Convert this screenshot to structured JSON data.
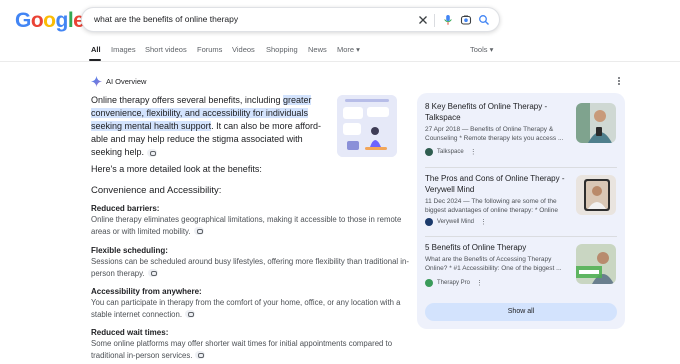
{
  "header": {
    "logo_letters": [
      "G",
      "o",
      "o",
      "g",
      "l",
      "e"
    ],
    "logo_colors": [
      "#4285f4",
      "#ea4335",
      "#fbbc05",
      "#4285f4",
      "#34a853",
      "#ea4335"
    ],
    "search_query": "what are the benefits of online therapy",
    "icons": [
      "close-icon",
      "microphone-icon",
      "lens-icon",
      "search-icon"
    ]
  },
  "tabs": {
    "items": [
      "All",
      "Images",
      "Short videos",
      "Forums",
      "Videos",
      "Shopping",
      "News",
      "More ▾"
    ],
    "active": "All",
    "tools": "Tools ▾"
  },
  "ai_overview": {
    "title": "AI Overview",
    "intro_plain_1": "Online therapy offers several benefits, including ",
    "intro_highlight": "greater convenience, flexibility, and accessibility for individuals seeking mental health support",
    "intro_plain_2": ". It can also be more afford-able and may help reduce the stigma associated with seeking help.",
    "lead": "Here's a more detailed look at the benefits:",
    "section_heading": "Convenience and Accessibility:",
    "items": [
      {
        "title": "Reduced barriers:",
        "body": "Online therapy eliminates geographical limitations, making it accessible to those in remote areas or with limited mobility."
      },
      {
        "title": "Flexible scheduling:",
        "body": "Sessions can be scheduled around busy lifestyles, offering more flexibility than traditional in-person therapy."
      },
      {
        "title": "Accessibility from anywhere:",
        "body": "You can participate in therapy from the comfort of your home, office, or any location with a stable internet connection."
      },
      {
        "title": "Reduced wait times:",
        "body": "Some online platforms may offer shorter wait times for initial appointments compared to traditional in-person services."
      }
    ]
  },
  "sources": {
    "cards": [
      {
        "title": "8 Key Benefits of Online Therapy - Talkspace",
        "meta": "27 Apr 2018 — Benefits of Online Therapy & Counseling * Remote therapy lets you access ...",
        "source": "Talkspace",
        "fav_color": "#2f5d50"
      },
      {
        "title": "The Pros and Cons of Online Therapy - Verywell Mind",
        "meta": "11 Dec 2024 — The following are some of the biggest advantages of online therapy: * Online ...",
        "source": "Verywell Mind",
        "fav_color": "#1b3a6b"
      },
      {
        "title": "5 Benefits of Online Therapy",
        "meta": "What are the Benefits of Accessing Therapy Online? * #1 Accessibility: One of the biggest ...",
        "source": "Therapy Pro",
        "fav_color": "#3a9b5a"
      }
    ],
    "show_all": "Show all"
  },
  "colors": {
    "accent": "#1a73e8",
    "highlight": "#d3e3fd",
    "panel": "#eef1fb"
  }
}
